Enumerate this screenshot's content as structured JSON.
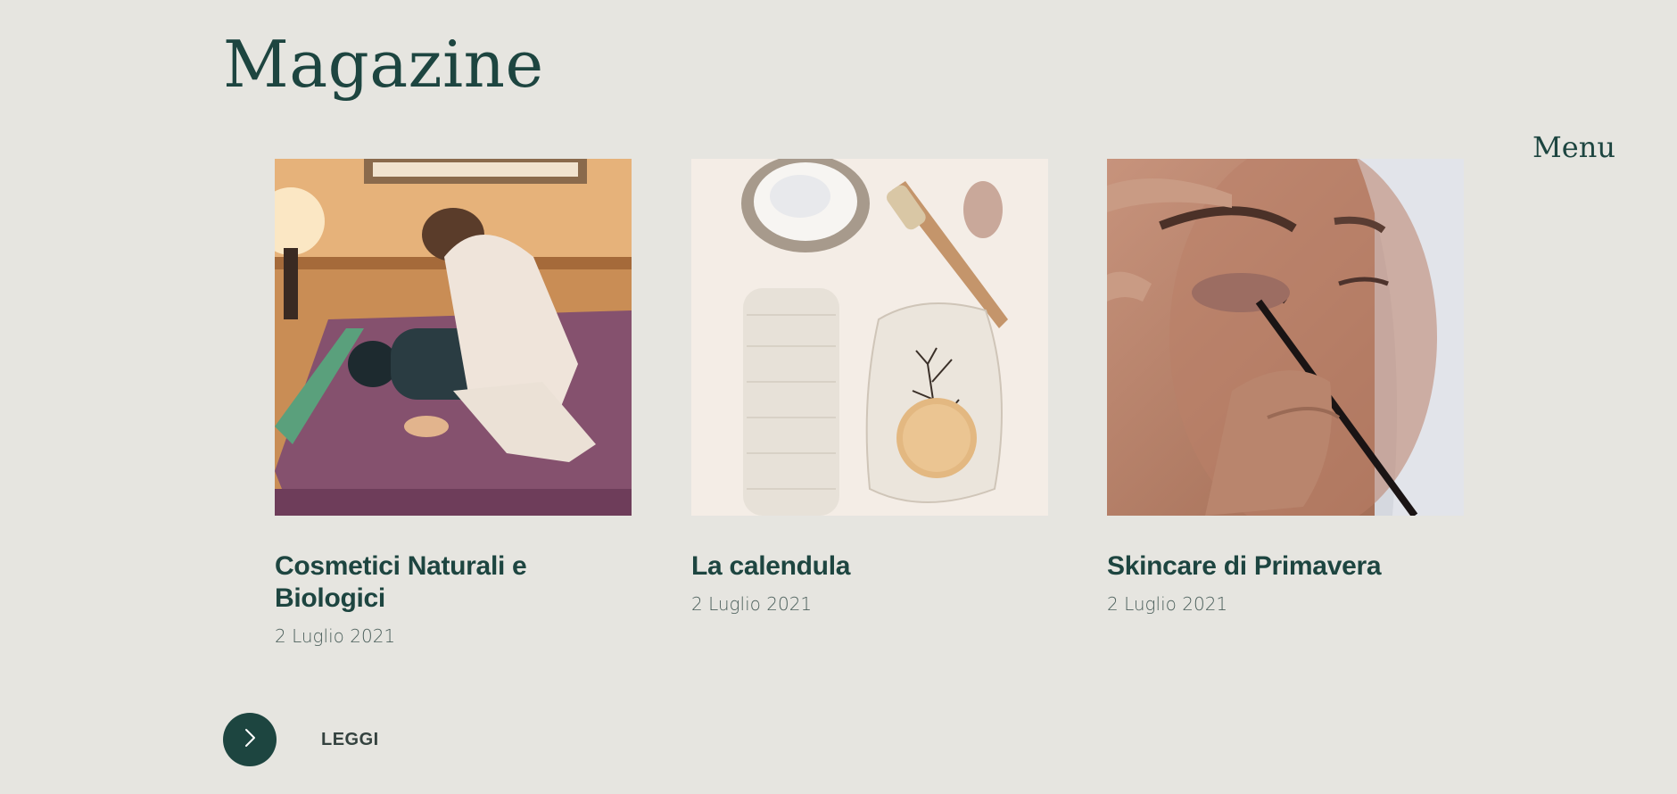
{
  "header": {
    "title": "Magazine",
    "menu_label": "Menu"
  },
  "cards": [
    {
      "title": "Cosmetici Naturali e Biologici",
      "date": "2 Luglio 2021",
      "image": "massage-photo"
    },
    {
      "title": "La calendula",
      "date": "2 Luglio 2021",
      "image": "spa-items-photo"
    },
    {
      "title": "Skincare di Primavera",
      "date": "2 Luglio 2021",
      "image": "eyeliner-photo"
    }
  ],
  "footer": {
    "next_icon": "chevron-right-icon",
    "read_label": "LEGGI"
  },
  "colors": {
    "background": "#e6e5e0",
    "accent": "#1d4540"
  }
}
